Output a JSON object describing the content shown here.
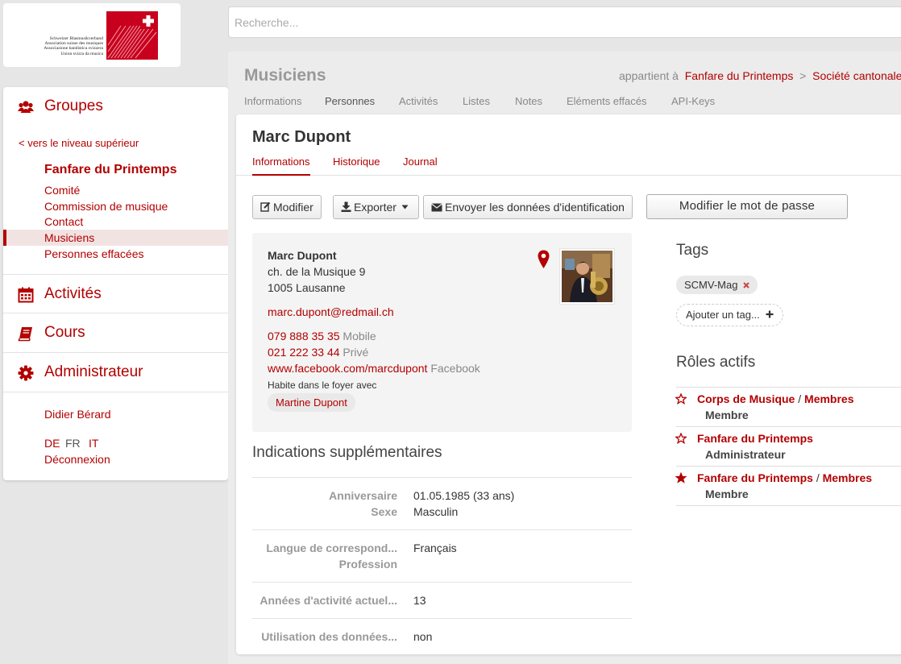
{
  "logo": {
    "lines": [
      "Schweizer Blasmusikverband",
      "Association suisse des musiques",
      "Associazione bandistica svizzera",
      "Union svizra da musica"
    ]
  },
  "search": {
    "placeholder": "Recherche..."
  },
  "sidebar": {
    "groups_label": "Groupes",
    "up_link": "< vers le niveau supérieur",
    "group_title": "Fanfare du Printemps",
    "subgroups": [
      "Comité",
      "Commission de musique",
      "Contact",
      "Musiciens",
      "Personnes effacées"
    ],
    "activities_label": "Activités",
    "courses_label": "Cours",
    "admin_label": "Administrateur",
    "user_name": "Didier Bérard",
    "languages": [
      "DE",
      "FR",
      "IT"
    ],
    "logout": "Déconnexion"
  },
  "main": {
    "title": "Musiciens",
    "belongs_prefix": "appartient à",
    "breadcrumb": [
      "Fanfare du Printemps",
      ">",
      "Société cantonale"
    ],
    "tabs": [
      "Informations",
      "Personnes",
      "Activités",
      "Listes",
      "Notes",
      "Eléments effacés",
      "API-Keys"
    ],
    "active_tab": "Personnes"
  },
  "person": {
    "name": "Marc Dupont",
    "tabs": [
      "Informations",
      "Historique",
      "Journal"
    ],
    "actions": {
      "edit": "Modifier",
      "export": "Exporter",
      "send_login": "Envoyer les données d'identification",
      "change_password": "Modifier le mot de passe"
    },
    "contact": {
      "name": "Marc Dupont",
      "street": "ch. de la Musique 9",
      "city": "1005 Lausanne",
      "email": "marc.dupont@redmail.ch",
      "phones": [
        {
          "number": "079 888 35 35",
          "type": "Mobile"
        },
        {
          "number": "021 222 33 44",
          "type": "Privé"
        }
      ],
      "social": {
        "url": "www.facebook.com/marcdupont",
        "type": "Facebook"
      },
      "household_label": "Habite dans le foyer avec",
      "household_member": "Martine Dupont"
    },
    "additional": {
      "heading": "Indications supplémentaires",
      "fields": [
        {
          "label": "Anniversaire",
          "value": "01.05.1985 (33 ans)"
        },
        {
          "label": "Sexe",
          "value": "Masculin"
        },
        {
          "label": "Langue de correspond...",
          "value": "Français"
        },
        {
          "label": "Profession",
          "value": ""
        },
        {
          "label": "Années d'activité actuel...",
          "value": "13"
        },
        {
          "label": "Utilisation des données...",
          "value": "non"
        }
      ]
    },
    "tags": {
      "heading": "Tags",
      "items": [
        "SCMV-Mag"
      ],
      "add_label": "Ajouter un tag..."
    },
    "roles": {
      "heading": "Rôles actifs",
      "items": [
        {
          "group": "Corps de Musique",
          "sub": "Membres",
          "role": "Membre",
          "primary": false
        },
        {
          "group": "Fanfare du Printemps",
          "sub": "",
          "role": "Administrateur",
          "primary": false
        },
        {
          "group": "Fanfare du Printemps",
          "sub": "Membres",
          "role": "Membre",
          "primary": true
        }
      ]
    }
  }
}
